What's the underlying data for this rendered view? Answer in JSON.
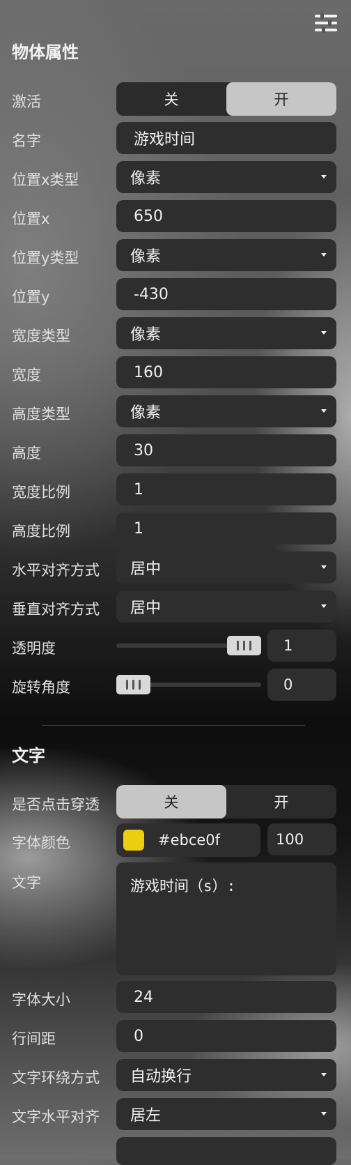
{
  "header": {
    "icon": "sliders-icon"
  },
  "section1": {
    "title": "物体属性"
  },
  "rows": {
    "active": {
      "label": "激活",
      "off": "关",
      "on": "开",
      "selected": "开"
    },
    "name": {
      "label": "名字",
      "value": "游戏时间"
    },
    "pos_x_type": {
      "label": "位置x类型",
      "value": "像素"
    },
    "pos_x": {
      "label": "位置x",
      "value": "650"
    },
    "pos_y_type": {
      "label": "位置y类型",
      "value": "像素"
    },
    "pos_y": {
      "label": "位置y",
      "value": "-430"
    },
    "width_type": {
      "label": "宽度类型",
      "value": "像素"
    },
    "width": {
      "label": "宽度",
      "value": "160"
    },
    "height_type": {
      "label": "高度类型",
      "value": "像素"
    },
    "height": {
      "label": "高度",
      "value": "30"
    },
    "width_scale": {
      "label": "宽度比例",
      "value": "1"
    },
    "height_scale": {
      "label": "高度比例",
      "value": "1"
    },
    "h_align": {
      "label": "水平对齐方式",
      "value": "居中"
    },
    "v_align": {
      "label": "垂直对齐方式",
      "value": "居中"
    },
    "opacity": {
      "label": "透明度",
      "value": "1",
      "slider_fraction": 1
    },
    "rotation": {
      "label": "旋转角度",
      "value": "0",
      "slider_fraction": 0
    }
  },
  "section2": {
    "title": "文字"
  },
  "text_rows": {
    "click_through": {
      "label": "是否点击穿透",
      "off": "关",
      "on": "开",
      "selected": "关"
    },
    "font_color": {
      "label": "字体颜色",
      "hex": "#ebce0f",
      "alpha": "100",
      "swatch_color": "#ebce0f"
    },
    "text": {
      "label": "文字",
      "value": "游戏时间（s）:"
    },
    "font_size": {
      "label": "字体大小",
      "value": "24"
    },
    "line_spacing": {
      "label": "行间距",
      "value": "0"
    },
    "wrap_mode": {
      "label": "文字环绕方式",
      "value": "自动换行"
    },
    "text_h_align": {
      "label": "文字水平对齐",
      "value": "居左"
    }
  }
}
